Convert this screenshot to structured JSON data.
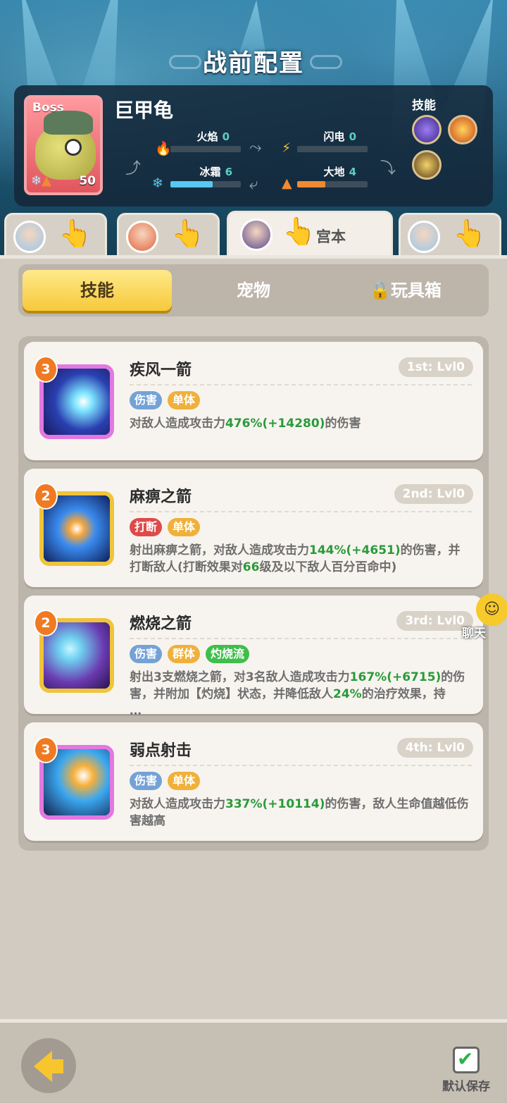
{
  "header": {
    "title": "战前配置"
  },
  "boss": {
    "tag": "Boss",
    "name": "巨甲龟",
    "level": "50",
    "stats": {
      "fire": {
        "label": "火焰",
        "value": "0",
        "fraction": 0.0,
        "color": "#d94a3a"
      },
      "lightning": {
        "label": "闪电",
        "value": "0",
        "fraction": 0.0,
        "color": "#f1c232"
      },
      "frost": {
        "label": "冰霜",
        "value": "6",
        "fraction": 0.6,
        "color": "#57c8f2"
      },
      "earth": {
        "label": "大地",
        "value": "4",
        "fraction": 0.4,
        "color": "#ef8a33"
      }
    },
    "skills_label": "技能"
  },
  "heroes": [
    {
      "name": "",
      "active": false
    },
    {
      "name": "",
      "active": false
    },
    {
      "name": "宫本",
      "active": true
    },
    {
      "name": "",
      "active": false
    }
  ],
  "tabs": [
    {
      "label": "技能",
      "active": true
    },
    {
      "label": "宠物",
      "active": false
    },
    {
      "label": "玩具箱",
      "active": false,
      "locked": true
    }
  ],
  "skills": [
    {
      "level": "3",
      "name": "疾风一箭",
      "rank": "1st: Lvl0",
      "tags": [
        {
          "text": "伤害",
          "color": "#74a2d6"
        },
        {
          "text": "单体",
          "color": "#f0b03a"
        }
      ],
      "desc_line1_pre": "对敌人造成攻击力",
      "desc_line1_num": "476%(+14280)",
      "desc_line1_post": "的伤害",
      "desc_line2": ""
    },
    {
      "level": "2",
      "name": "麻痹之箭",
      "rank": "2nd: Lvl0",
      "tags": [
        {
          "text": "打断",
          "color": "#e04a4a"
        },
        {
          "text": "单体",
          "color": "#f0b03a"
        }
      ],
      "desc_line1_pre": "射出麻痹之箭，对敌人造成攻击力",
      "desc_line1_num": "144%(+4651)",
      "desc_line1_post": "的伤害，并",
      "desc_line2_pre": "打断敌人(打断效果对",
      "desc_line2_num": "66",
      "desc_line2_post": "级及以下敌人百分百命中)"
    },
    {
      "level": "2",
      "name": "燃烧之箭",
      "rank": "3rd: Lvl0",
      "tags": [
        {
          "text": "伤害",
          "color": "#74a2d6"
        },
        {
          "text": "群体",
          "color": "#f0b03a"
        },
        {
          "text": "灼烧流",
          "color": "#3fbe4a"
        }
      ],
      "desc_line1_pre": "射出3支燃烧之箭，对3名敌人造成攻击力",
      "desc_line1_num": "167%(+6715)",
      "desc_line1_post": "的伤",
      "desc_line2_pre": "害，并附加【灼烧】状态，并降低敌人",
      "desc_line2_num": "24%",
      "desc_line2_post": "的治疗效果，持",
      "desc_line3": "…"
    },
    {
      "level": "3",
      "name": "弱点射击",
      "rank": "4th: Lvl0",
      "tags": [
        {
          "text": "伤害",
          "color": "#74a2d6"
        },
        {
          "text": "单体",
          "color": "#f0b03a"
        }
      ],
      "desc_line1_pre": "对敌人造成攻击力",
      "desc_line1_num": "337%(+10114)",
      "desc_line1_post": "的伤害，敌人生命值越低伤",
      "desc_line2": "害越高"
    }
  ],
  "chat": {
    "label": "聊天"
  },
  "footer": {
    "save_label": "默认保存"
  }
}
